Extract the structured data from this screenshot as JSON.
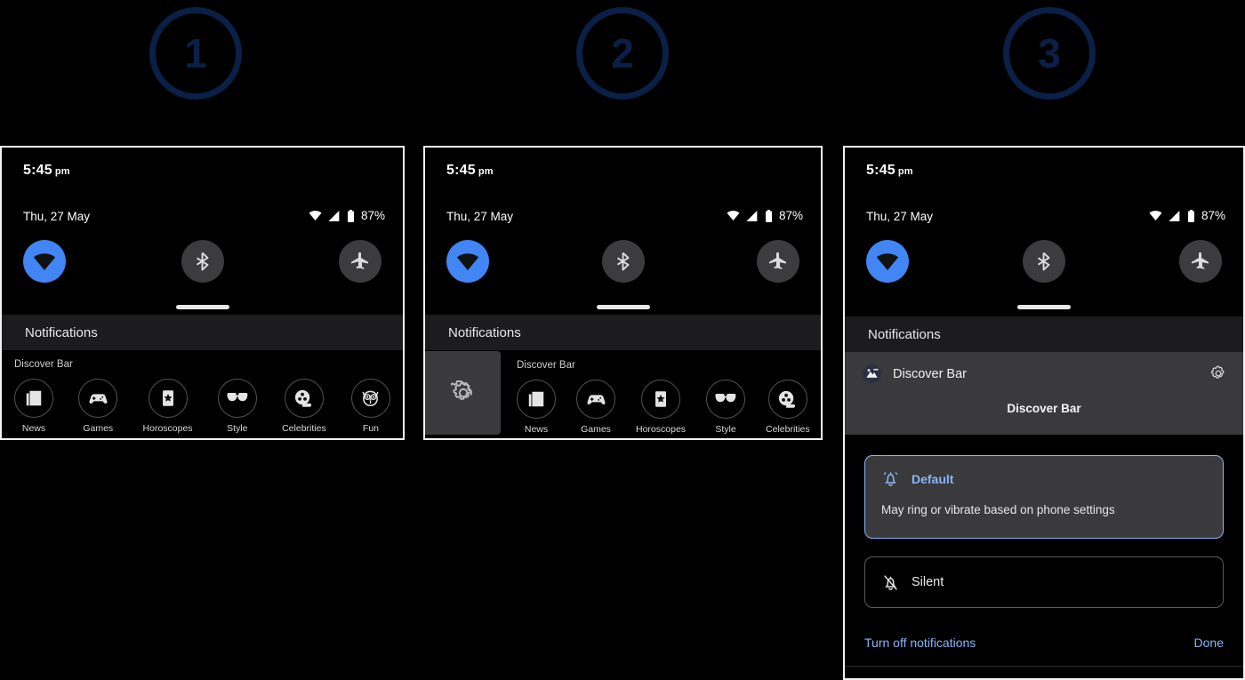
{
  "steps": [
    {
      "number": "1"
    },
    {
      "number": "2"
    },
    {
      "number": "3"
    }
  ],
  "colors": {
    "step_badge": "#0a2047",
    "accent_blue": "#8ab4f8",
    "wifi_tile_on": "#4285f4",
    "panel_border": "#f2f2f2",
    "shade_bg": "#000000",
    "notif_header_bg": "#1c1c1e",
    "card_bg": "#3a3a3c"
  },
  "status_bar": {
    "time": "5:45",
    "ampm": "pm",
    "date": "Thu, 27 May",
    "battery_percent": "87%",
    "icons": [
      "wifi-icon",
      "signal-icon",
      "battery-icon"
    ]
  },
  "quick_settings": {
    "tiles": [
      {
        "name": "wifi-tile",
        "icon": "wifi-icon",
        "state": "on"
      },
      {
        "name": "bluetooth-tile",
        "icon": "bluetooth-icon",
        "state": "off"
      },
      {
        "name": "airplane-tile",
        "icon": "airplane-icon",
        "state": "off"
      }
    ]
  },
  "notifications": {
    "header": "Notifications"
  },
  "panel1": {
    "discover": {
      "title": "Discover Bar",
      "chips": [
        {
          "label": "News",
          "icon": "newspaper-icon"
        },
        {
          "label": "Games",
          "icon": "gamepad-icon"
        },
        {
          "label": "Horoscopes",
          "icon": "star-card-icon"
        },
        {
          "label": "Style",
          "icon": "sunglasses-icon"
        },
        {
          "label": "Celebrities",
          "icon": "film-reel-icon"
        },
        {
          "label": "Fun",
          "icon": "owl-icon"
        }
      ]
    }
  },
  "panel2": {
    "swipe_action_icon": "gear-icon",
    "discover": {
      "title": "Discover Bar",
      "chips": [
        {
          "label": "News",
          "icon": "newspaper-icon"
        },
        {
          "label": "Games",
          "icon": "gamepad-icon"
        },
        {
          "label": "Horoscopes",
          "icon": "star-card-icon"
        },
        {
          "label": "Style",
          "icon": "sunglasses-icon"
        },
        {
          "label": "Celebrities",
          "icon": "film-reel-icon"
        }
      ]
    }
  },
  "panel3": {
    "app_name": "Discover Bar",
    "channel_name": "Discover Bar",
    "settings_icon": "gear-icon",
    "app_icon": "discover-bar-app-icon",
    "options": [
      {
        "title": "Default",
        "description": "May ring or vibrate based on phone settings",
        "icon": "bell-ringing-icon",
        "selected": true
      },
      {
        "title": "Silent",
        "description": "",
        "icon": "bell-off-icon",
        "selected": false
      }
    ],
    "footer": {
      "turn_off": "Turn off notifications",
      "done": "Done"
    }
  }
}
